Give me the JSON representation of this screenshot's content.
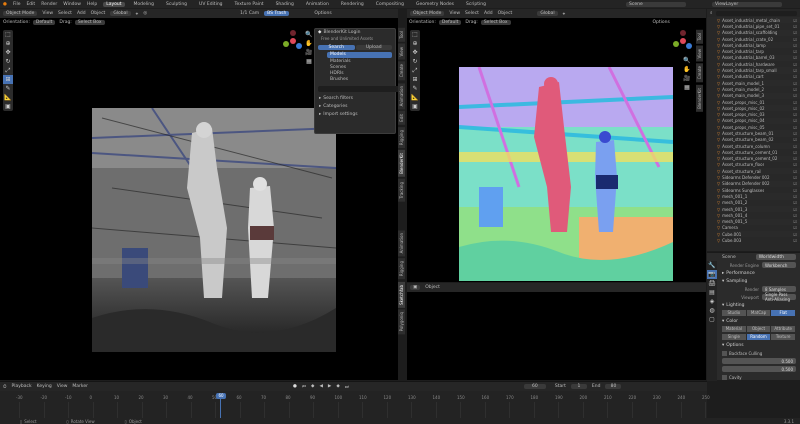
{
  "menubar": {
    "menus": [
      "File",
      "Edit",
      "Render",
      "Window",
      "Help"
    ],
    "workspaces": [
      "Layout",
      "Modeling",
      "Sculpting",
      "UV Editing",
      "Texture Paint",
      "Shading",
      "Animation",
      "Rendering",
      "Compositing",
      "Geometry Nodes",
      "Scripting"
    ],
    "active_workspace": "Layout",
    "scene": "Scene",
    "view_layer": "ViewLayer"
  },
  "left_viewport": {
    "mode": "Object Mode",
    "menus": [
      "View",
      "Select",
      "Add",
      "Object"
    ],
    "orientation_label": "Orientation:",
    "orientation": "Default",
    "drag_label": "Drag:",
    "drag": "Select Box",
    "transform": "Global",
    "overlay_label": "1/1 Cam",
    "header_right": "BS Trash",
    "options": "Options"
  },
  "asset_popup": {
    "title": "BlenderKit Login",
    "subtitle": "Free and Unlimited Assets",
    "search_label": "Search",
    "upload_label": "Upload",
    "categories": [
      "Models",
      "Materials",
      "Scenes",
      "HDRIs",
      "Brushes"
    ],
    "search_placeholder": "",
    "links": [
      "Search filters",
      "Categories",
      "Import settings"
    ]
  },
  "n_panel_tabs": [
    "Tool",
    "View",
    "Create",
    "Animation",
    "Edit",
    "Rigging",
    "BlenderKit",
    "Tracking"
  ],
  "right_viewport": {
    "mode": "Object Mode",
    "menus": [
      "View",
      "Select",
      "Add",
      "Object"
    ],
    "transform": "Global",
    "orientation_label": "Orientation:",
    "orientation": "Default",
    "drag_label": "Drag:",
    "drag": "Select Box",
    "options": "Options",
    "lower_editor_label": "Object"
  },
  "right_n_tabs": [
    "Tool",
    "View",
    "Create",
    "Animation",
    "Rigging",
    "Sketchfab",
    "BlenderKit",
    "Polygoniq"
  ],
  "outliner": {
    "items": [
      "Asset_industrial_metal_chain",
      "Asset_industrial_pipe_set_01",
      "Asset_industrial_scaffolding",
      "Asset_industrial_crate_02",
      "Asset_industrial_lamp",
      "Asset_industrial_tarp",
      "Asset_industrial_barrel_03",
      "Asset_industrial_hardware",
      "Asset_industrial_tarp_small",
      "Asset_industrial_cart",
      "Asset_main_model_1",
      "Asset_main_model_2",
      "Asset_main_model_3",
      "Asset_props_misc_01",
      "Asset_props_misc_02",
      "Asset_props_misc_03",
      "Asset_props_misc_04",
      "Asset_props_misc_05",
      "Asset_structure_beam_01",
      "Asset_structure_beam_02",
      "Asset_structure_column",
      "Asset_structure_cement_01",
      "Asset_structure_cement_02",
      "Asset_structure_floor",
      "Asset_structure_rail",
      "Sidearms Defender 002",
      "Sidearms Defender 002",
      "Sidearms Sunglasses",
      "mesh_001_1",
      "mesh_001_2",
      "mesh_001_3",
      "mesh_001_4",
      "mesh_001_5",
      "Camera",
      "Cube.001",
      "Cube.003"
    ]
  },
  "properties": {
    "scene_name": "Scene",
    "world_name": "Worldwidth",
    "render_engine_label": "Render Engine",
    "render_engine": "Workbench",
    "sections": {
      "performance": "Performance",
      "sampling": "Sampling",
      "lighting": "Lighting",
      "color": "Color",
      "options": "Options",
      "backface_culling": "Backface Culling",
      "cavity": "Cavity"
    },
    "render_label": "Render",
    "render_value": "8 Samples",
    "viewport_label": "Viewport",
    "viewport_value": "Single Pass Anti-Aliasing",
    "lighting_opts": [
      "Studio",
      "MatCap",
      "Flat"
    ],
    "lighting_active": "Flat",
    "color_opts_row1": [
      "Material",
      "Object",
      "Attribute"
    ],
    "color_opts_row2": [
      "Single",
      "Random",
      "Texture"
    ],
    "color_active": "Random",
    "xray_value": "0.500",
    "shadow_value": "0.500"
  },
  "timeline": {
    "menus": [
      "Playback",
      "Keying",
      "View",
      "Marker"
    ],
    "current_frame": "60",
    "start_label": "Start",
    "start": "1",
    "end_label": "End",
    "end": "80",
    "ruler": [
      "-30",
      "-20",
      "-10",
      "0",
      "10",
      "20",
      "30",
      "40",
      "50",
      "60",
      "70",
      "80",
      "90",
      "100",
      "110",
      "120",
      "130",
      "140",
      "150",
      "160",
      "170",
      "180",
      "190",
      "200",
      "210",
      "220",
      "230",
      "240",
      "250"
    ],
    "playhead": "60"
  },
  "statusbar": {
    "items": [
      "Select",
      "Rotate View",
      "Object"
    ],
    "version": "3.3.1"
  },
  "colors": {
    "accent": "#4772b3",
    "playhead": "#4772b3",
    "background": "#1d1d1d"
  }
}
